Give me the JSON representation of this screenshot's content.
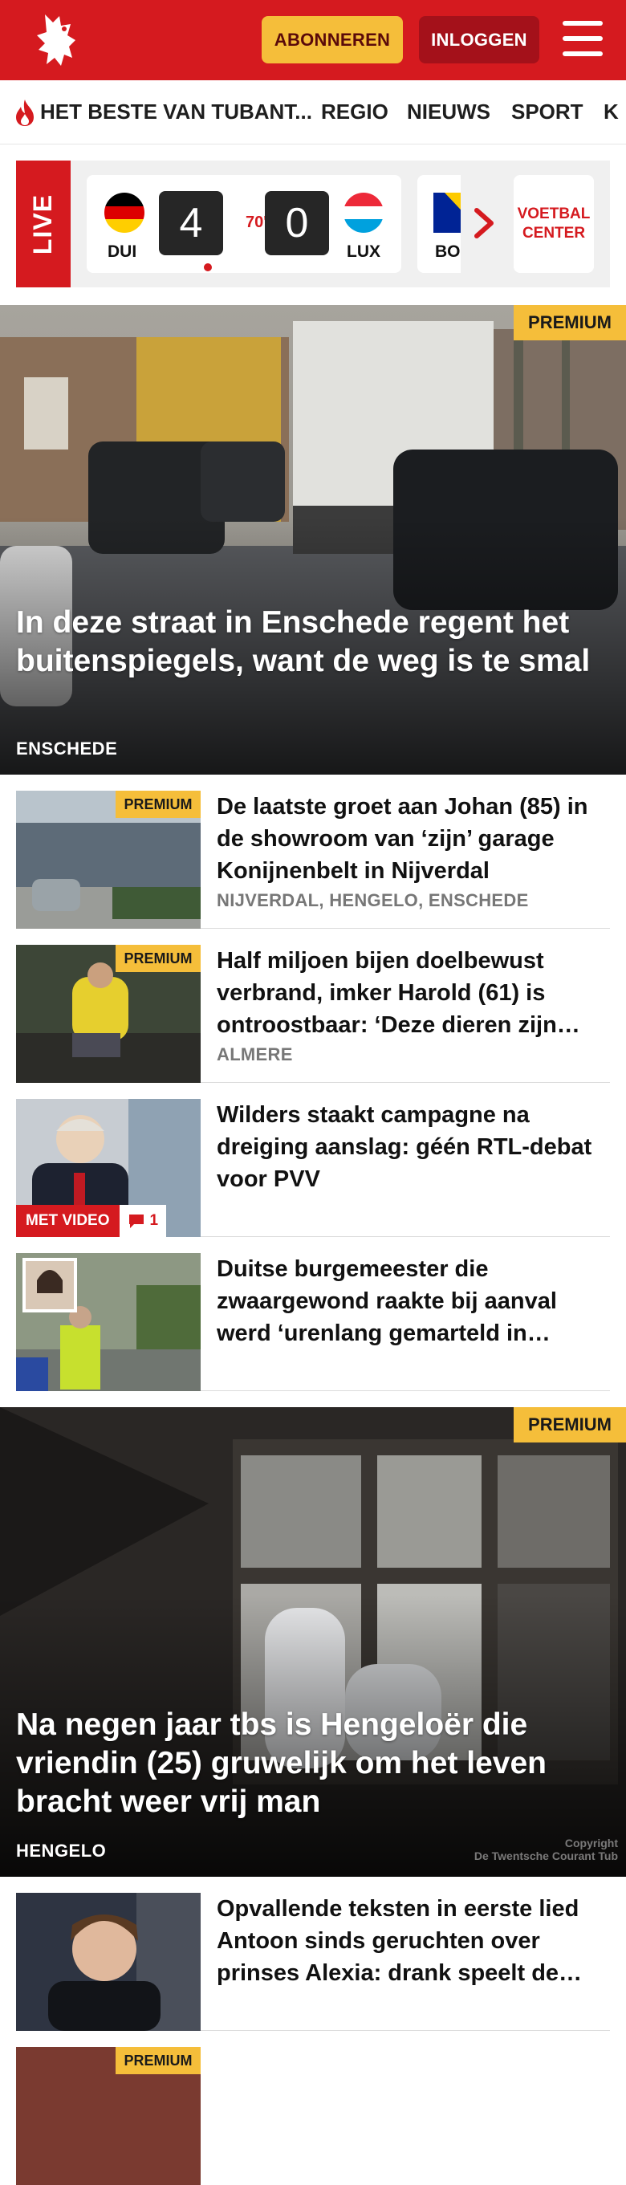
{
  "header": {
    "subscribe_label": "ABONNEREN",
    "login_label": "INLOGGEN"
  },
  "nav": {
    "items": [
      "HET BESTE VAN TUBANT...",
      "REGIO",
      "NIEUWS",
      "SPORT",
      "K"
    ]
  },
  "live": {
    "label": "LIVE",
    "match": {
      "home_code": "DUI",
      "away_code": "LUX",
      "home_score": "4",
      "away_score": "0",
      "minute": "70'"
    },
    "next_match_code": "BO",
    "voetbal_center_line1": "VOETBAL",
    "voetbal_center_line2": "CENTER"
  },
  "hero1": {
    "premium": "PREMIUM",
    "title": "In deze straat in Enschede regent het buitenspiegels, want de weg is te smal",
    "location": "ENSCHEDE"
  },
  "articles": [
    {
      "premium": "PREMIUM",
      "title": "De laatste groet aan Johan (85) in de showroom van ‘zijn’ garage Konijnenbelt in Nijverdal",
      "location": "NIJVERDAL, HENGELO, ENSCHEDE"
    },
    {
      "premium": "PREMIUM",
      "title": "Half miljoen bijen doelbewust verbrand, imker Harold (61) is ontroostbaar: ‘Deze dieren zijn…",
      "location": "ALMERE"
    },
    {
      "video_label": "MET VIDEO",
      "comment_count": "1",
      "title": "Wilders staakt campagne na dreiging aanslag: géén RTL-debat voor PVV"
    },
    {
      "title": "Duitse burgemeester die zwaargewond raakte bij aanval werd ‘urenlang gemarteld in…"
    }
  ],
  "hero2": {
    "premium": "PREMIUM",
    "title": "Na negen jaar tbs is Hengeloër die vriendin (25) gruwelijk om het leven bracht weer vrij man",
    "location": "HENGELO",
    "copyright_line1": "Copyright",
    "copyright_line2": "De Twentsche Courant Tub"
  },
  "article5": {
    "title": "Opvallende teksten in eerste lied Antoon sinds geruchten over prinses Alexia: drank speelt de…"
  },
  "article6": {
    "premium": "PREMIUM"
  },
  "colors": {
    "brand_red": "#d51a1f",
    "premium_yellow": "#f5be3a",
    "login_dark_red": "#a4111a"
  }
}
